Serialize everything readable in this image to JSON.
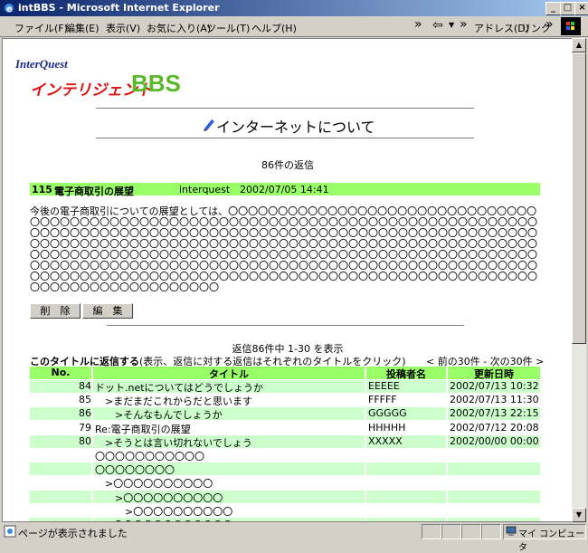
{
  "window": {
    "title": "intBBS - Microsoft Internet Explorer"
  },
  "menu": [
    "ファイル(F)",
    "編集(E)",
    "表示(V)",
    "お気に入り(A)",
    "ツール(T)",
    "ヘルプ(H)"
  ],
  "toolbar": {
    "back_label": "⇦",
    "chevron": "»",
    "address_label": "アドレス(D)",
    "links_label": "リンク"
  },
  "logo": {
    "brand": "InterQuest",
    "name_kana": "インテリジェント",
    "name_bbs": "BBS"
  },
  "page": {
    "title": "インターネットについて",
    "reply_count": "86件の返信"
  },
  "post": {
    "number": "115",
    "subject": "電子商取引の展望",
    "author": "interquest",
    "date": "2002/07/05 14:41",
    "body": "今後の電子商取引についての展望としては、〇〇〇〇〇〇〇〇〇〇〇〇〇〇〇〇〇〇〇〇〇〇〇〇〇〇〇〇〇〇〇〇〇〇〇〇〇〇〇〇〇〇〇〇〇〇〇〇〇〇〇〇〇〇〇〇〇〇〇〇〇〇〇〇〇〇〇〇〇〇〇〇〇〇〇〇〇〇〇〇〇〇〇〇〇〇〇〇〇〇〇〇〇〇〇〇〇〇〇〇〇〇〇〇〇〇〇〇〇〇〇〇〇〇〇〇〇〇〇〇〇〇〇〇〇〇〇〇〇〇〇〇〇〇〇〇〇〇〇〇〇〇〇〇〇〇〇〇〇〇〇〇〇〇〇〇〇〇〇〇〇〇〇〇〇〇〇〇〇〇〇〇〇〇〇〇〇〇〇〇〇〇〇〇〇〇〇〇〇〇〇〇〇〇〇〇〇〇〇〇〇〇〇〇〇〇〇〇〇〇〇〇〇〇〇〇〇〇〇〇〇〇〇〇〇〇〇〇〇〇〇〇〇〇〇〇〇〇〇〇〇〇〇〇〇〇〇〇〇〇〇〇〇〇〇〇〇〇〇〇〇〇〇〇〇〇〇〇〇〇〇〇〇〇〇〇〇〇〇〇〇〇〇〇〇〇〇〇〇〇〇〇〇〇〇〇〇〇〇〇〇〇〇〇〇〇〇〇〇〇〇〇〇〇〇〇〇〇〇〇〇〇〇〇〇〇〇〇〇〇〇〇〇〇〇〇〇〇〇〇〇〇〇〇〇〇〇〇〇〇〇〇〇〇〇〇",
    "delete_label": "削　除",
    "edit_label": "編　集"
  },
  "replies": {
    "summary": "返信86件中 1-30 を表示",
    "instruction_bold": "このタイトルに返信する",
    "instruction_rest": "(表示、返信に対する返信はそれぞれのタイトルをクリック)",
    "pager": "< 前の30件 - 次の30件 >",
    "headers": [
      "No.",
      "タイトル",
      "投稿者名",
      "更新日時"
    ],
    "rows": [
      {
        "no": "84",
        "title": "ドット.netについてはどうでしょうか",
        "author": "EEEEE",
        "date": "2002/07/13 10:32"
      },
      {
        "no": "85",
        "title": "　>まだまだこれからだと思います",
        "author": "FFFFF",
        "date": "2002/07/13 11:30"
      },
      {
        "no": "86",
        "title": "　　>そんなもんでしょうか",
        "author": "GGGGG",
        "date": "2002/07/13 22:15"
      },
      {
        "no": "79",
        "title": "Re:電子商取引の展望",
        "author": "HHHHH",
        "date": "2002/07/12 20:08"
      },
      {
        "no": "80",
        "title": "　>そうとは言い切れないでしょう",
        "author": "XXXXX",
        "date": "2002/00/00 00:00"
      },
      {
        "no": "",
        "title": "〇〇〇〇〇〇〇〇〇〇〇",
        "author": "",
        "date": ""
      },
      {
        "no": "",
        "title": "〇〇〇〇〇〇〇〇",
        "author": "",
        "date": ""
      },
      {
        "no": "",
        "title": "　>〇〇〇〇〇〇〇〇〇〇",
        "author": "",
        "date": ""
      },
      {
        "no": "",
        "title": "　　>〇〇〇〇〇〇〇〇〇〇",
        "author": "",
        "date": ""
      },
      {
        "no": "",
        "title": "　　　>〇〇〇〇〇〇〇〇〇〇",
        "author": "",
        "date": ""
      },
      {
        "no": "",
        "title": "　>〇〇〇〇〇〇〇〇〇〇〇〇",
        "author": "",
        "date": ""
      }
    ]
  },
  "status": {
    "text": "ページが表示されました",
    "zone": "マイ コンピュータ"
  },
  "colors": {
    "row_green": "#99ff66",
    "row_light": "#ccffcc",
    "titlebar": "#0a246a"
  }
}
